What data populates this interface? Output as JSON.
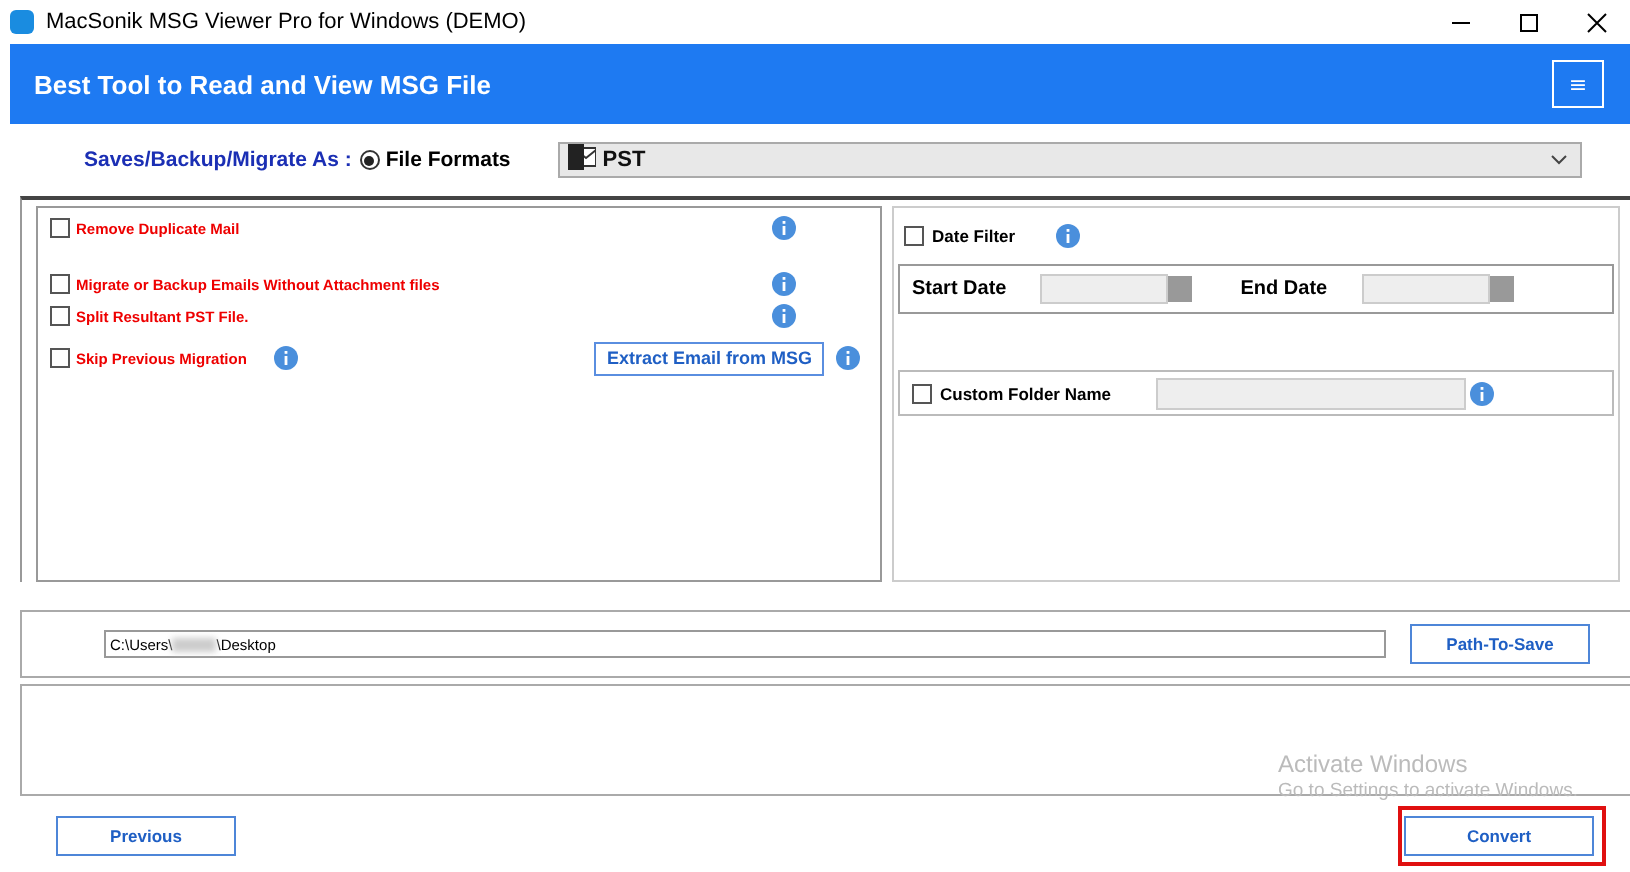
{
  "window": {
    "title": "MacSonik MSG Viewer Pro for Windows (DEMO)"
  },
  "header": {
    "title": "Best Tool to Read and View MSG File",
    "menu_glyph": "≡"
  },
  "format_row": {
    "label": "Saves/Backup/Migrate As :",
    "radio": {
      "label": "File Formats",
      "selected": true
    },
    "select": {
      "value": "PST"
    }
  },
  "options": [
    {
      "kind": "option",
      "label": "Remove Duplicate Mail",
      "checked": false
    },
    {
      "kind": "option",
      "label": "Migrate or Backup Emails Without Attachment files",
      "checked": false
    },
    {
      "kind": "option",
      "label": "Split Resultant PST File.",
      "checked": false
    },
    {
      "kind": "inline",
      "label": "Skip Previous Migration",
      "checked": false
    }
  ],
  "extract_button": "Extract Email from MSG",
  "date_filter": {
    "label": "Date Filter",
    "checked": false,
    "start_label": "Start Date",
    "end_label": "End Date"
  },
  "custom_folder": {
    "label": "Custom Folder Name",
    "checked": false
  },
  "path": {
    "value_start": "C:\\Users\\",
    "value_end": "\\Desktop",
    "button": "Path-To-Save"
  },
  "buttons": {
    "previous": "Previous",
    "convert": "Convert",
    "convert_highlighted": true
  },
  "activation_notice": {
    "title": "Activate Windows",
    "text": "Go to Settings to activate Windows."
  }
}
